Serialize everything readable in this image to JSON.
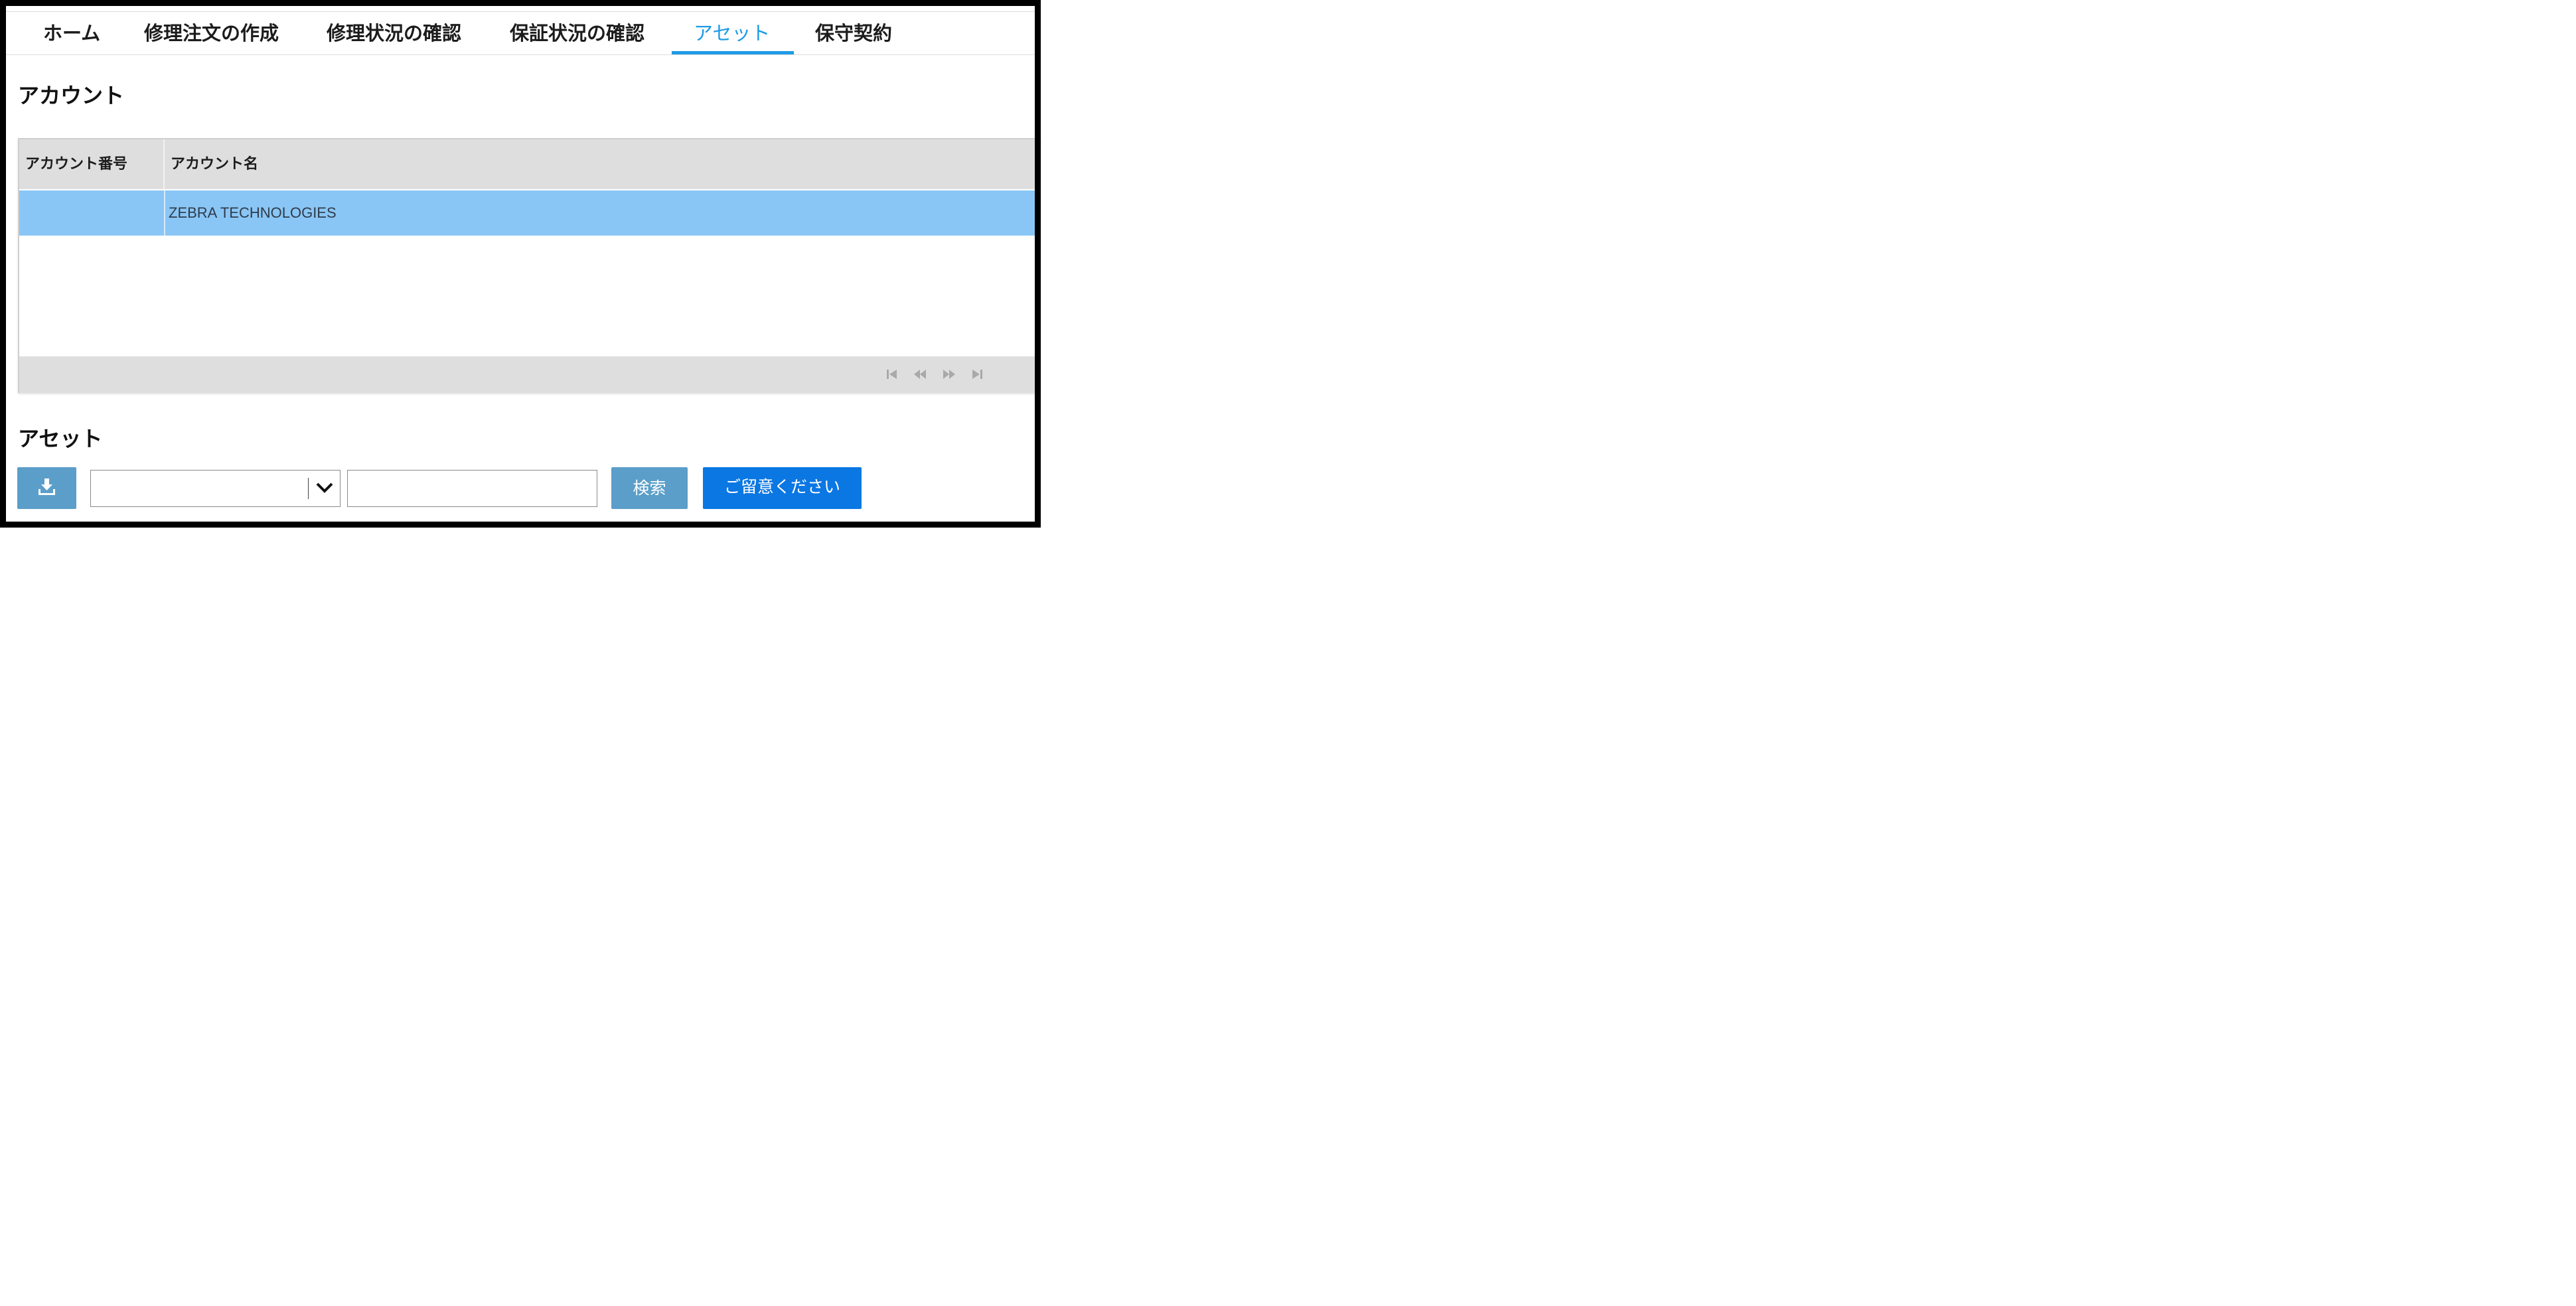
{
  "nav": {
    "tabs": [
      {
        "label": "ホーム"
      },
      {
        "label": "修理注文の作成"
      },
      {
        "label": "修理状況の確認"
      },
      {
        "label": "保証状況の確認"
      },
      {
        "label": "アセット",
        "active": true
      },
      {
        "label": "保守契約"
      }
    ],
    "accent_color": "#1e9be6"
  },
  "account_section": {
    "title": "アカウント",
    "table": {
      "columns": [
        "アカウント番号",
        "アカウント名"
      ],
      "rows": [
        {
          "account_number": "",
          "account_name": "ZEBRA TECHNOLOGIES",
          "selected": true
        }
      ],
      "selected_row_color": "#8ac6f5",
      "pager_icons": [
        "first-page-icon",
        "previous-page-icon",
        "next-page-icon",
        "last-page-icon"
      ]
    }
  },
  "asset_section": {
    "title": "アセット",
    "toolbar": {
      "download_icon": "download-icon",
      "filter_select_value": "",
      "search_input_value": "",
      "search_label": "検索",
      "notice_label": "ご留意ください",
      "button_color": "#5b9ec9",
      "notice_color": "#0b77e3"
    }
  }
}
